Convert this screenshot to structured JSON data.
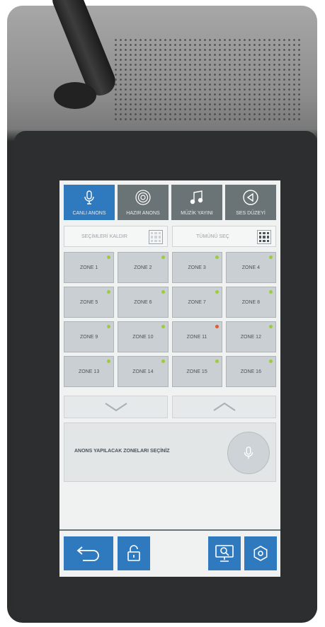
{
  "tabs": [
    {
      "label": "CANLI ANONS",
      "icon": "mic-icon",
      "active": true
    },
    {
      "label": "HAZIR ANONS",
      "icon": "broadcast-icon",
      "active": false
    },
    {
      "label": "MÜZİK YAYINI",
      "icon": "music-note-icon",
      "active": false
    },
    {
      "label": "SES DÜZEYİ",
      "icon": "volume-icon",
      "active": false
    }
  ],
  "selection": {
    "clear_label": "SEÇİMLERİ KALDIR",
    "select_all_label": "TÜMÜNÜ SEÇ"
  },
  "zones": [
    {
      "label": "ZONE 1",
      "status": "green"
    },
    {
      "label": "ZONE 2",
      "status": "green"
    },
    {
      "label": "ZONE 3",
      "status": "green"
    },
    {
      "label": "ZONE 4",
      "status": "green"
    },
    {
      "label": "ZONE 5",
      "status": "green"
    },
    {
      "label": "ZONE 6",
      "status": "green"
    },
    {
      "label": "ZONE 7",
      "status": "green"
    },
    {
      "label": "ZONE 8",
      "status": "green"
    },
    {
      "label": "ZONE 9",
      "status": "green"
    },
    {
      "label": "ZONE 10",
      "status": "green"
    },
    {
      "label": "ZONE 11",
      "status": "red"
    },
    {
      "label": "ZONE 12",
      "status": "green"
    },
    {
      "label": "ZONE 13",
      "status": "green"
    },
    {
      "label": "ZONE 14",
      "status": "green"
    },
    {
      "label": "ZONE 15",
      "status": "green"
    },
    {
      "label": "ZONE 16",
      "status": "green"
    }
  ],
  "message": {
    "text": "ANONS YAPILACAK ZONELARI SEÇİNİZ"
  },
  "bottom_icons": [
    "back-icon",
    "lock-icon",
    "monitor-search-icon",
    "settings-icon"
  ],
  "colors": {
    "accent": "#2f79bf",
    "tab": "#6a7376",
    "zone_ok": "#9ccc3c",
    "zone_error": "#e05b2e"
  }
}
